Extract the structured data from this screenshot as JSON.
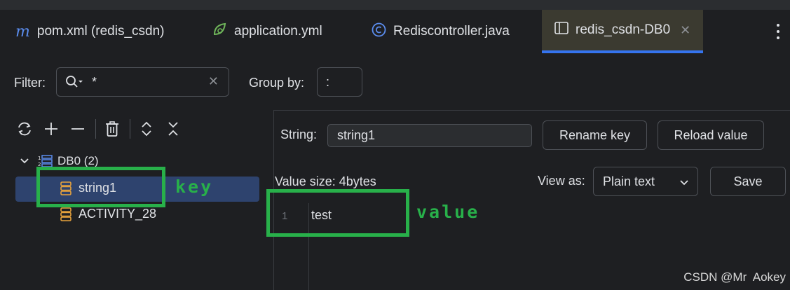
{
  "tabs": [
    {
      "label": "pom.xml (redis_csdn)",
      "icon": "maven-icon"
    },
    {
      "label": "application.yml",
      "icon": "spring-icon"
    },
    {
      "label": "Rediscontroller.java",
      "icon": "class-icon"
    },
    {
      "label": "redis_csdn-DB0",
      "icon": "table-icon",
      "active": true
    }
  ],
  "filter": {
    "label": "Filter:",
    "value": "*"
  },
  "group_by": {
    "label": "Group by:",
    "value": ":"
  },
  "tree": {
    "db_label": "DB0 (2)",
    "keys": [
      "string1",
      "ACTIVITY_28"
    ]
  },
  "editor": {
    "string_label": "String:",
    "key_value": "string1",
    "rename_label": "Rename key",
    "reload_label": "Reload value",
    "value_size": "Value size: 4bytes",
    "view_as_label": "View as:",
    "view_as_value": "Plain text",
    "save_label": "Save",
    "line_number": "1",
    "line_text": "test"
  },
  "annotations": {
    "key": "key",
    "value": "value"
  },
  "watermark": "CSDN @Mr  Aokey",
  "colors": {
    "accent": "#3574f0",
    "annotation": "#28b04a",
    "selection": "#2e436e",
    "key_icon": "#e8a33d"
  }
}
